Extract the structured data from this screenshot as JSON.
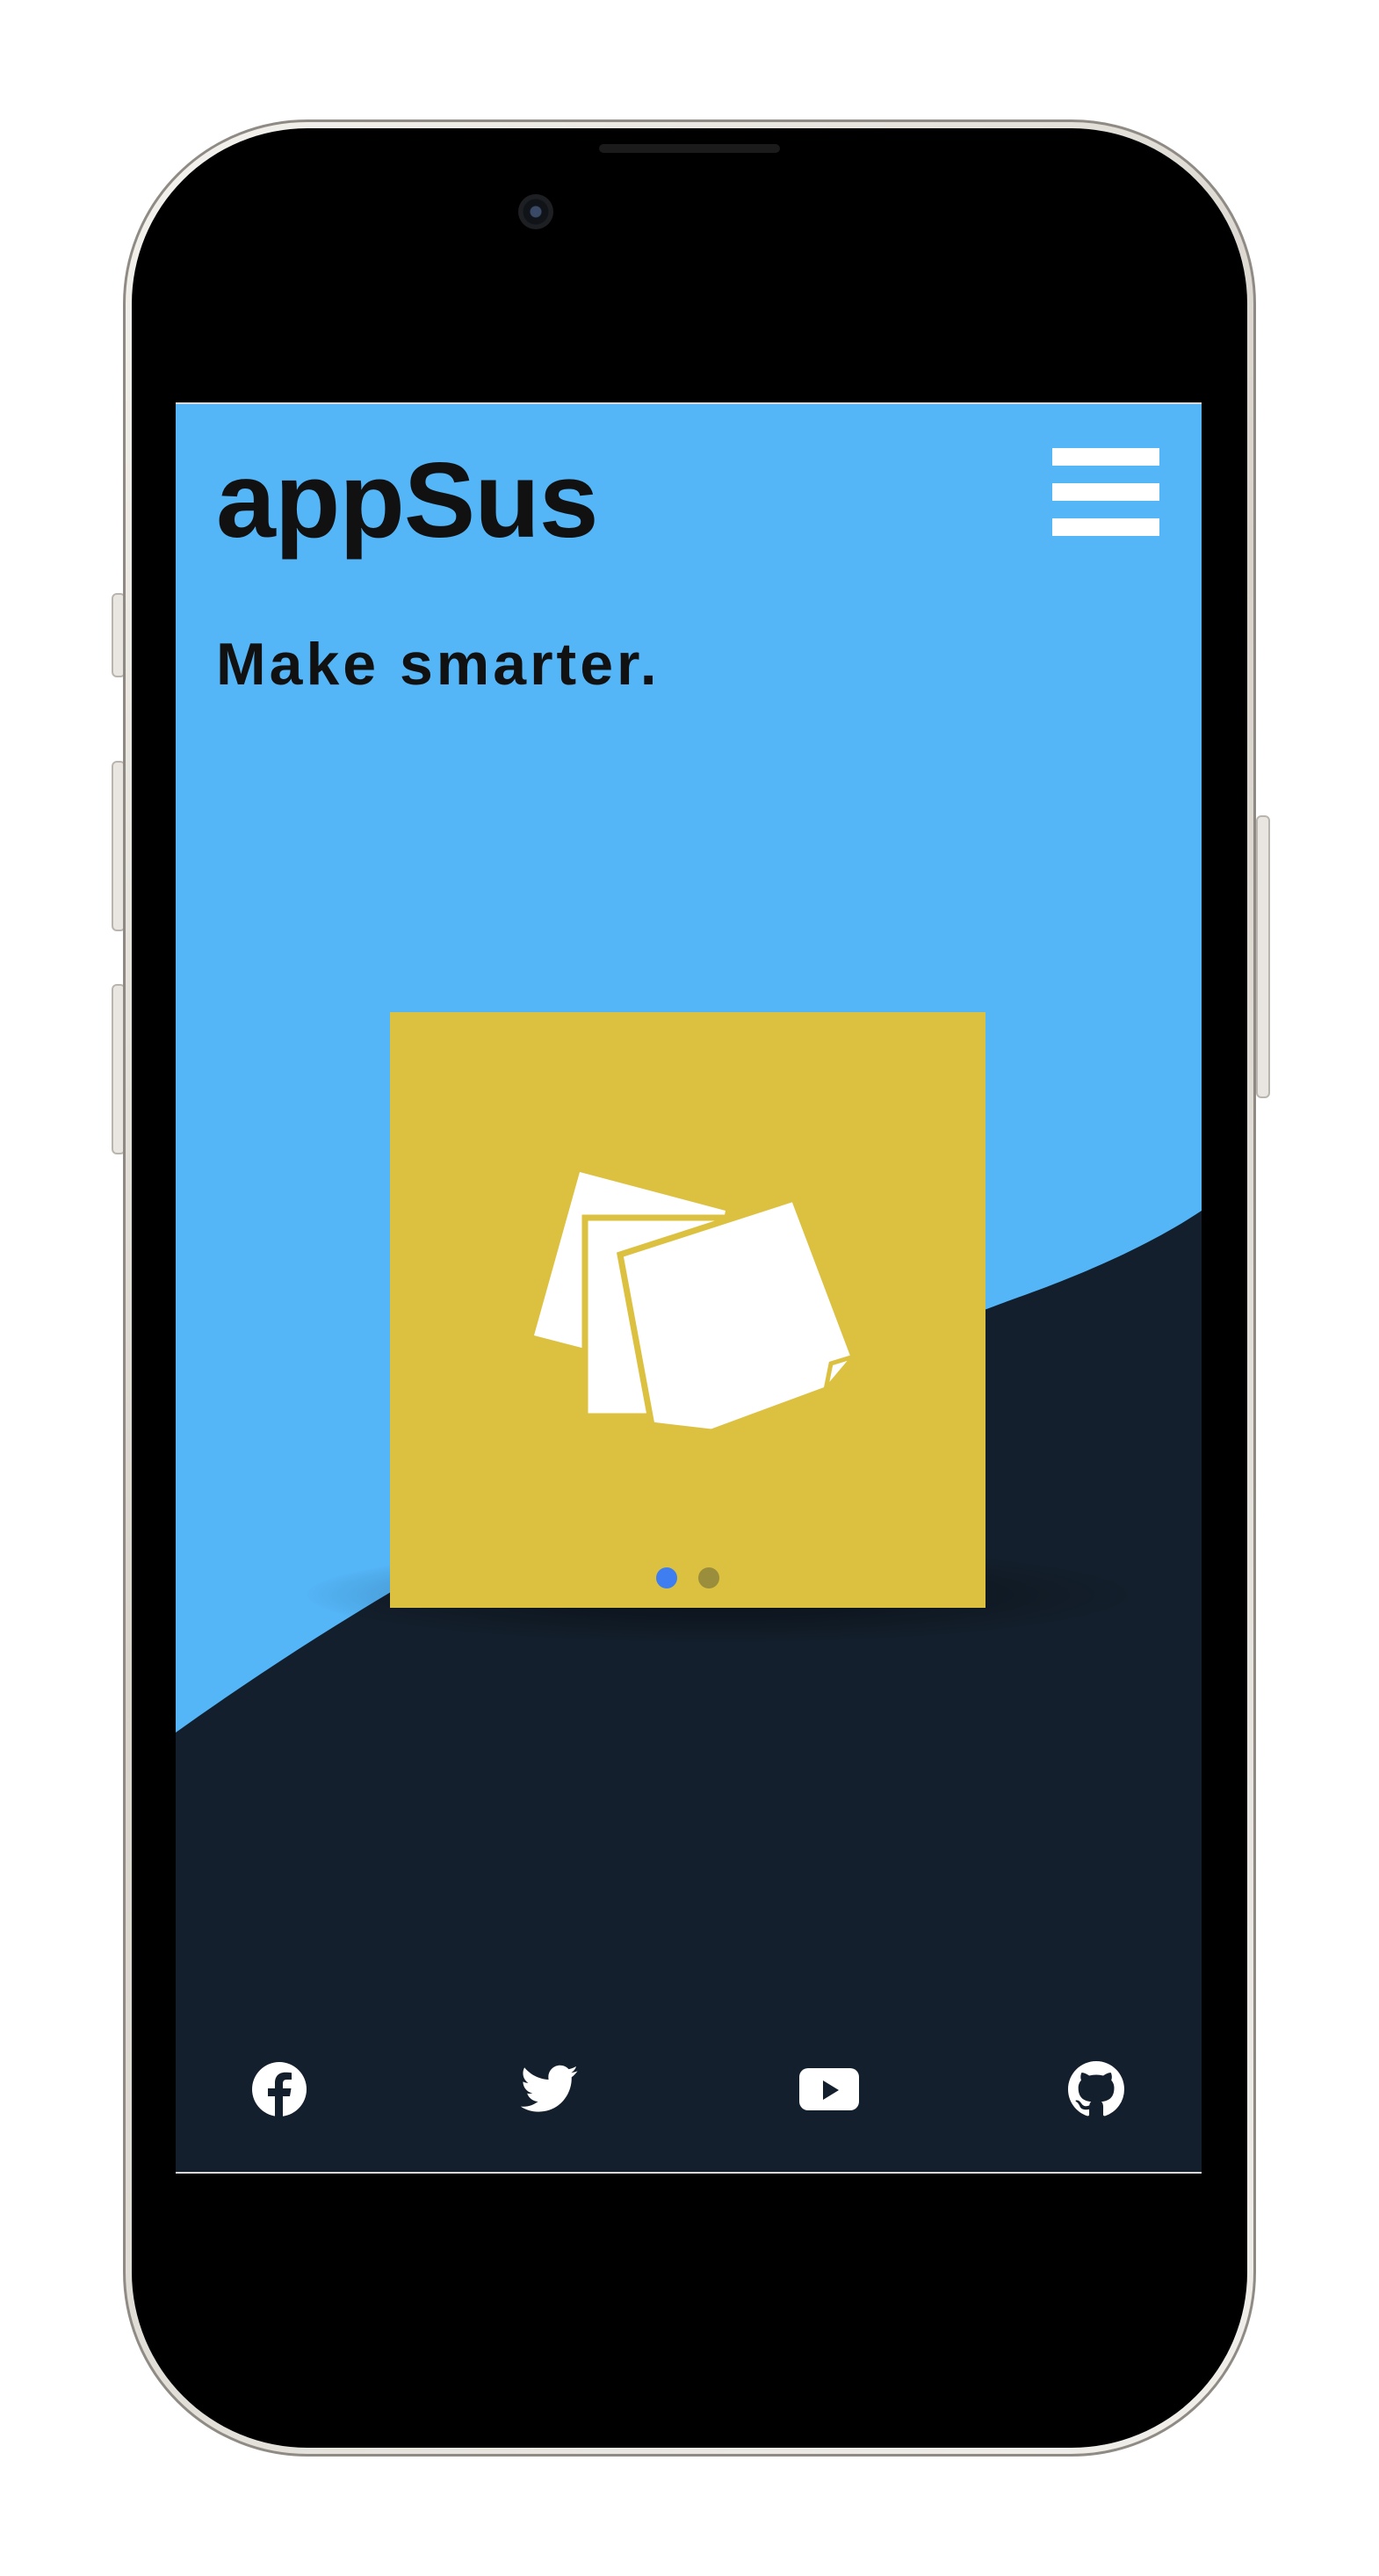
{
  "app": {
    "brand": "appSus",
    "tagline": "Make smarter."
  },
  "carousel": {
    "slide_count": 2,
    "active_slide": 1,
    "slide_icon": "sticky-notes-icon"
  },
  "footer": {
    "social_links": [
      {
        "icon": "facebook-icon"
      },
      {
        "icon": "twitter-icon"
      },
      {
        "icon": "youtube-icon"
      },
      {
        "icon": "github-icon"
      }
    ]
  },
  "colors": {
    "sky_blue": "#54b5f7",
    "navy": "#131f2c",
    "card_yellow": "#dcc141",
    "dot_active": "#3f7ef0",
    "dot_inactive": "#9a8d3c",
    "text_dark": "#111111",
    "icon_white": "#ffffff"
  }
}
